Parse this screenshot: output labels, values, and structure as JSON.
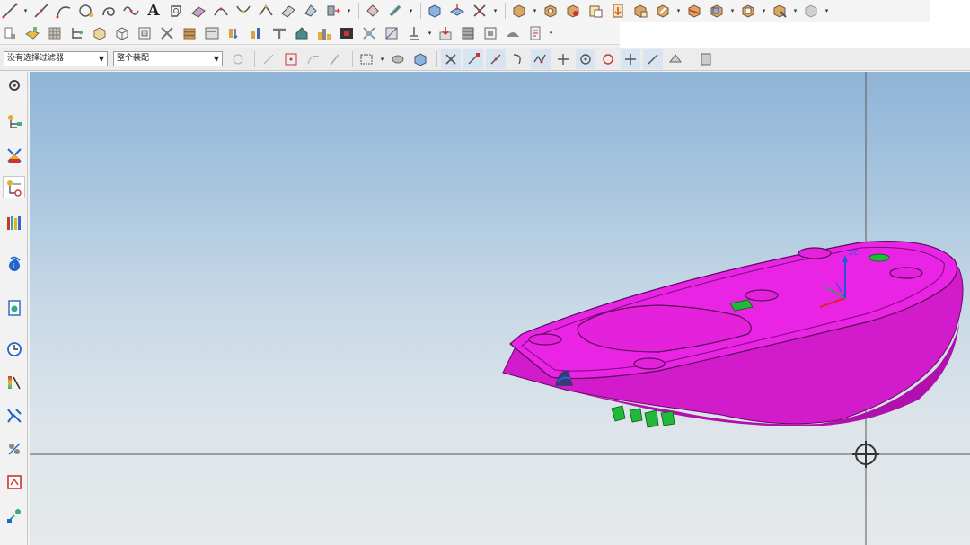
{
  "toolbar": {
    "row1_icons": [
      "line-icon",
      "arc-icon",
      "curve-icon",
      "spline-icon",
      "helix-icon",
      "sine-curve-icon",
      "text-icon",
      "offset-face-icon",
      "surface-icon",
      "bridge-icon",
      "blend-curve-icon",
      "trim-icon",
      "extend-icon",
      "mirror-icon",
      "sew-icon",
      "thicken-icon",
      "cube-icon",
      "shell-icon",
      "cross-icon",
      "box-feature-icon",
      "box-blend-icon",
      "box-hole-icon",
      "box-copy-icon",
      "box-note-icon",
      "box-star-icon",
      "box-edit-icon",
      "box-move-icon",
      "box-split-icon",
      "box-cut-icon",
      "box-merge-icon",
      "box-settings-icon",
      "sphere-gray-icon"
    ],
    "row2_icons": [
      "doc-icon",
      "box-yellow-icon",
      "grid-box-icon",
      "tree-icon",
      "cube-outline-icon",
      "cube-wire-icon",
      "layers-icon",
      "tools-icon",
      "stack-icon",
      "panel-icon",
      "arrow-split-icon",
      "columns-icon",
      "t-shape-icon",
      "house-icon",
      "city-icon",
      "film-icon",
      "scale-icon",
      "box-grid-icon",
      "pin-icon",
      "import-icon",
      "table-icon",
      "frame-icon",
      "arc-gray-icon",
      "doc-red-icon"
    ],
    "text_tool": "A",
    "filter_select": "没有选择过滤器",
    "assembly_select": "整个装配"
  },
  "sidebar": {
    "items": [
      "settings-icon",
      "assembly-navigator-icon",
      "constraint-navigator-icon",
      "part-navigator-icon",
      "reuse-library-icon",
      "web-browser-icon",
      "history-icon",
      "clock-icon",
      "process-icon",
      "role-icon",
      "system-materials-icon",
      "analysis-icon",
      "assembly-tool-icon"
    ]
  },
  "colors": {
    "part": "#e81ee0",
    "part_dark": "#b010aa",
    "feature_green": "#22b83a",
    "viewport_top": "#8fb4d7",
    "viewport_bottom": "#e6e9eb"
  }
}
